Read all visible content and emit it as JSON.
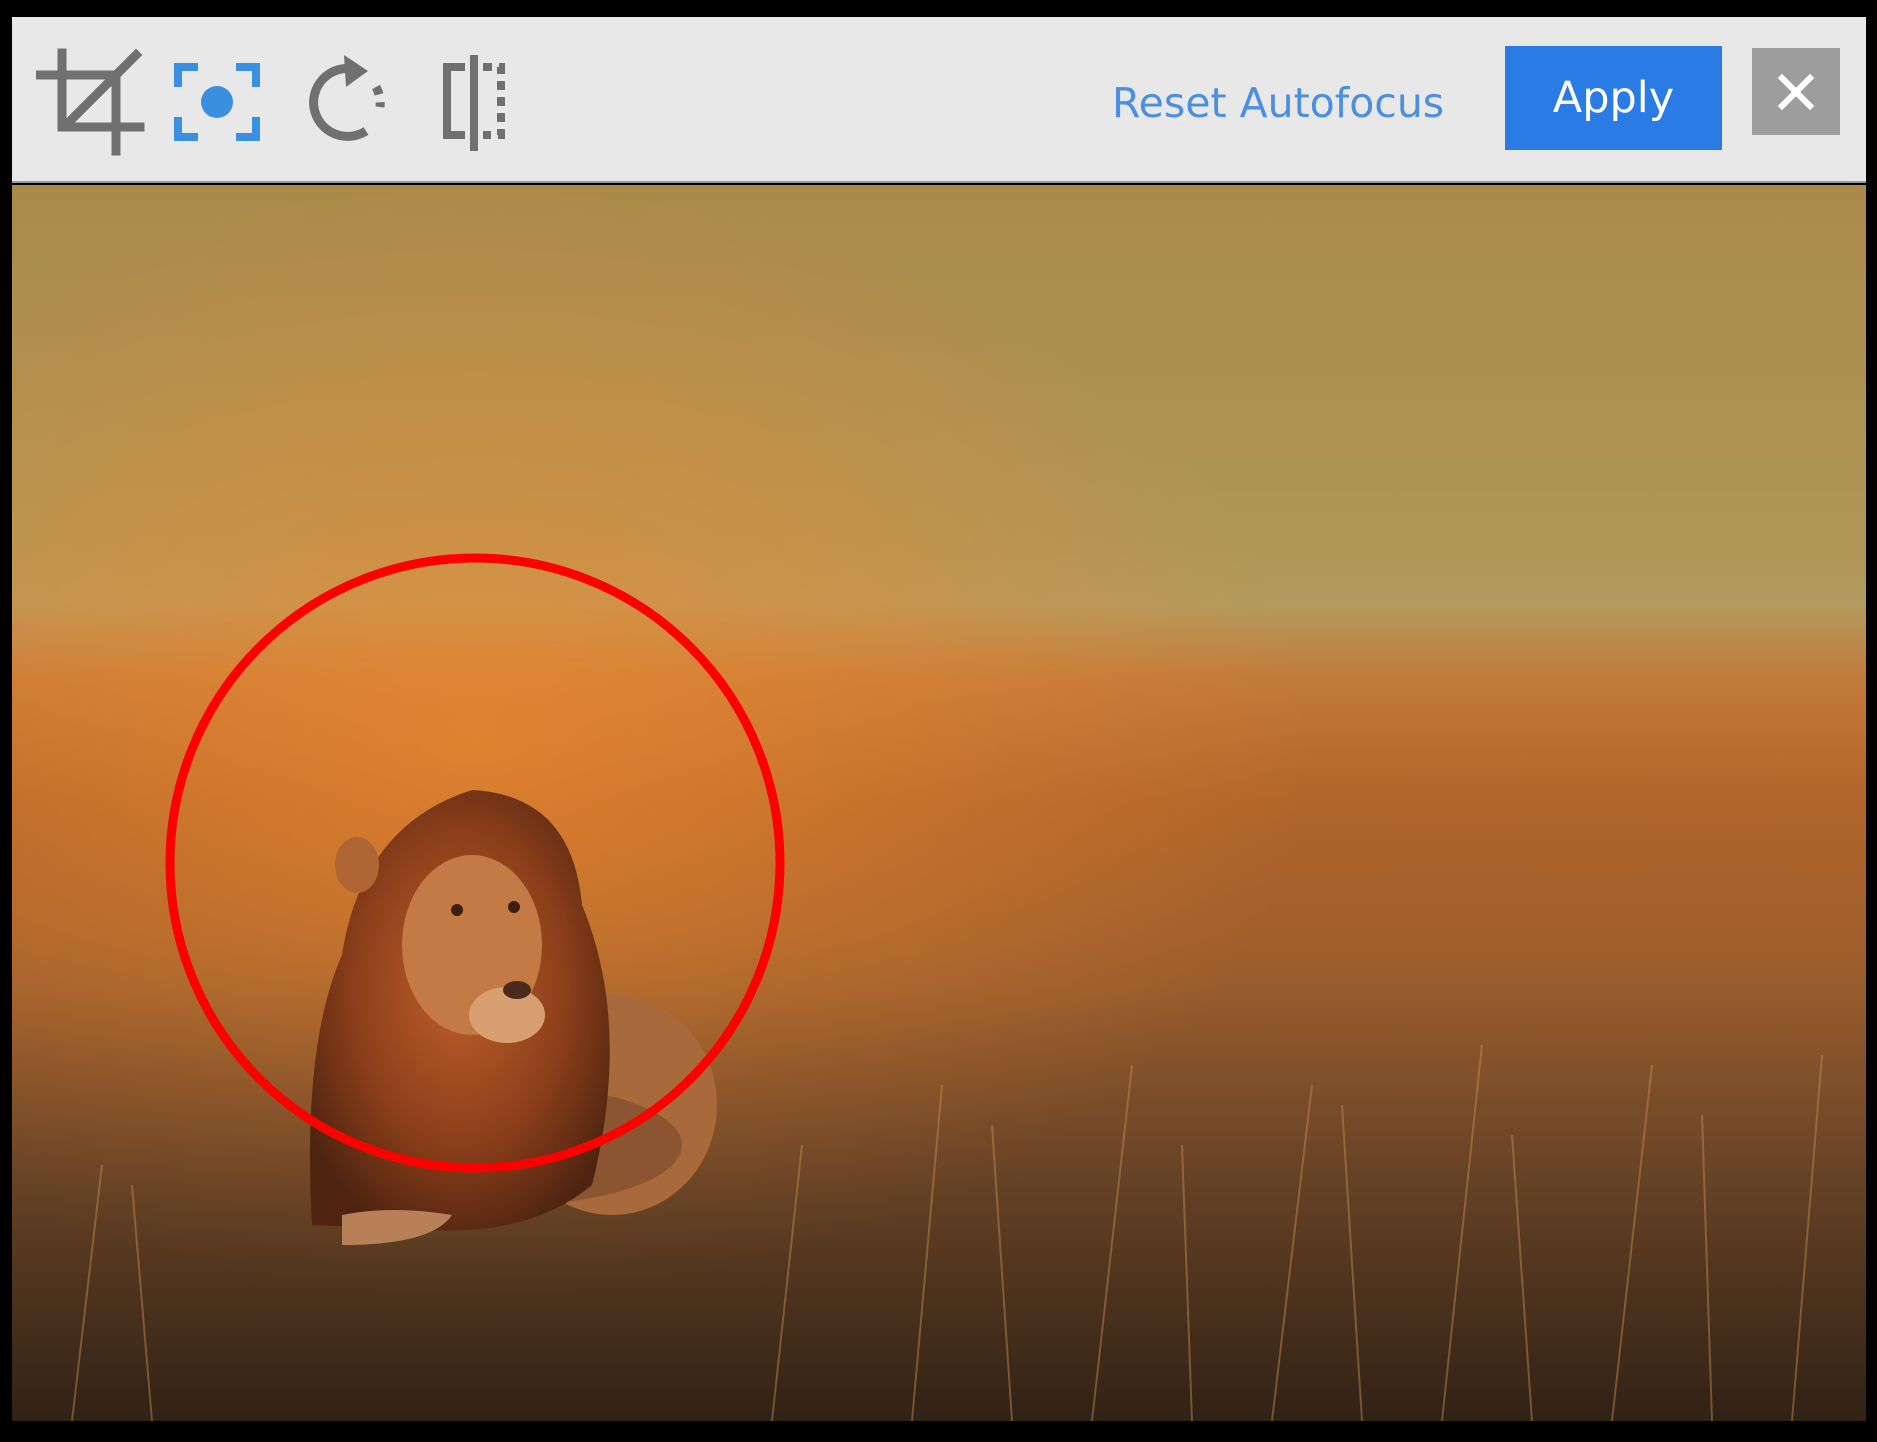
{
  "toolbar": {
    "tools": [
      {
        "icon": "crop-icon"
      },
      {
        "icon": "autofocus-icon",
        "active": true
      },
      {
        "icon": "rotate-icon"
      },
      {
        "icon": "flip-icon"
      }
    ],
    "reset_label": "Reset Autofocus",
    "apply_label": "Apply",
    "close_icon": "close-icon"
  },
  "colors": {
    "toolbar_bg": "#e8e8e8",
    "tool_icon": "#707070",
    "active_tool_icon": "#3a8fe0",
    "link": "#4a8fe0",
    "apply_bg": "#2b7be5",
    "close_bg": "#9d9d9d",
    "focus_ring": "#ff0000"
  },
  "canvas": {
    "subject": "lion lying in golden grassland at sunset",
    "focus_marker": "circle"
  }
}
